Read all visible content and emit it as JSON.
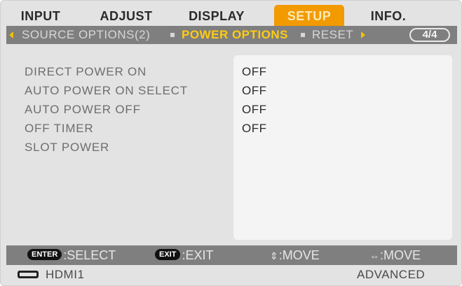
{
  "tabs": [
    {
      "label": "INPUT",
      "active": false
    },
    {
      "label": "ADJUST",
      "active": false
    },
    {
      "label": "DISPLAY",
      "active": false
    },
    {
      "label": "SETUP",
      "active": true
    },
    {
      "label": "INFO.",
      "active": false
    }
  ],
  "subtabs": [
    {
      "label": "SOURCE OPTIONS(2)",
      "active": false
    },
    {
      "label": "POWER OPTIONS",
      "active": true
    },
    {
      "label": "RESET",
      "active": false
    }
  ],
  "page_indicator": "4/4",
  "settings": [
    {
      "label": "DIRECT POWER ON",
      "value": "OFF"
    },
    {
      "label": "AUTO POWER ON SELECT",
      "value": "OFF"
    },
    {
      "label": "AUTO POWER OFF",
      "value": "OFF"
    },
    {
      "label": "OFF TIMER",
      "value": "OFF"
    },
    {
      "label": "SLOT POWER",
      "value": ""
    }
  ],
  "hints": [
    {
      "key": "ENTER",
      "label": ":SELECT"
    },
    {
      "key": "EXIT",
      "label": ":EXIT"
    },
    {
      "icon": "up-down-arrow-icon",
      "glyph": "⇕",
      "label": ":MOVE"
    },
    {
      "icon": "left-right-arrow-icon",
      "glyph": "⇔",
      "label": ":MOVE"
    }
  ],
  "status": {
    "source": "HDMI1",
    "mode": "ADVANCED"
  },
  "colors": {
    "active_tab": "#f29a00",
    "active_subtab": "#ffcc11",
    "bar": "#7f7f7f",
    "panel": "#f4f4f4"
  }
}
